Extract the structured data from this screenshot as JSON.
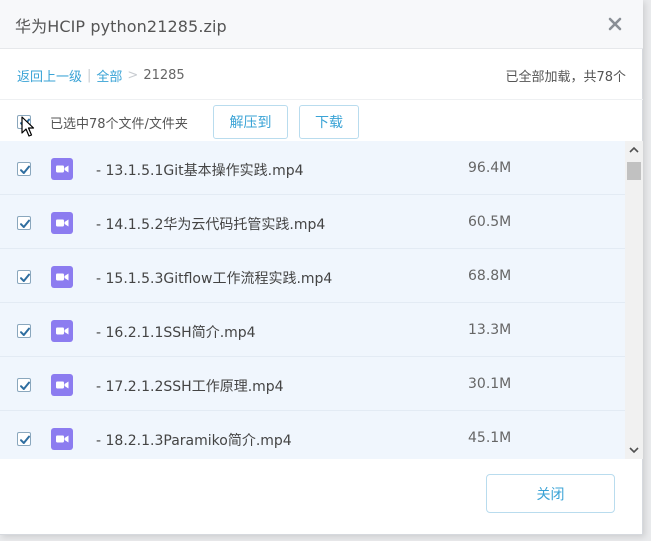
{
  "dialog": {
    "title": "华为HCIP python21285.zip",
    "close_icon": "close-icon"
  },
  "breadcrumb": {
    "back": "返回上一级",
    "divider": "|",
    "all": "全部",
    "arrow": ">",
    "current": "21285"
  },
  "status": {
    "loaded": "已全部加载，共78个"
  },
  "toolbar": {
    "selected_text": "已选中78个文件/文件夹",
    "extract_label": "解压到",
    "download_label": "下载"
  },
  "files": [
    {
      "name": "- 13.1.5.1Git基本操作实践.mp4",
      "size": "96.4M",
      "checked": true
    },
    {
      "name": "- 14.1.5.2华为云代码托管实践.mp4",
      "size": "60.5M",
      "checked": true
    },
    {
      "name": "- 15.1.5.3Gitflow工作流程实践.mp4",
      "size": "68.8M",
      "checked": true
    },
    {
      "name": "- 16.2.1.1SSH简介.mp4",
      "size": "13.3M",
      "checked": true
    },
    {
      "name": "- 17.2.1.2SSH工作原理.mp4",
      "size": "30.1M",
      "checked": true
    },
    {
      "name": "- 18.2.1.3Paramiko简介.mp4",
      "size": "45.1M",
      "checked": true
    }
  ],
  "footer": {
    "close_label": "关闭"
  },
  "colors": {
    "accent": "#3aa3d6",
    "video_icon": "#8c7cf0",
    "row_bg": "#f0f6fd",
    "checkbox_mark": "#2f6ea0"
  }
}
